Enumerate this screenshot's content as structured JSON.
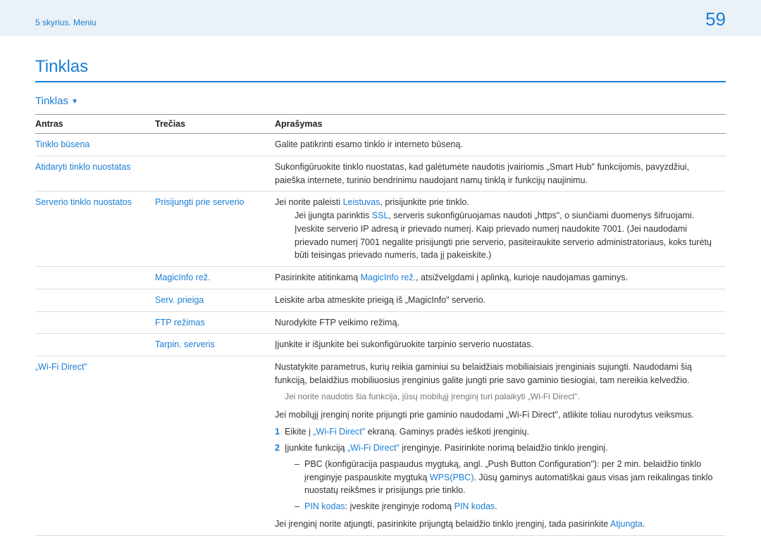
{
  "header": {
    "chapter": "5 skyrius. Meniu",
    "page": "59"
  },
  "title": "Tinklas",
  "sub": "Tinklas",
  "thead": {
    "c1": "Antras",
    "c2": "Trečias",
    "c3": "Aprašymas"
  },
  "rows": {
    "r1": {
      "a": "Tinklo būsena",
      "d": "Galite patikrinti esamo tinklo ir interneto būseną."
    },
    "r2": {
      "a": "Atidaryti tinklo nuostatas",
      "d": "Sukonfigūruokite tinklo nuostatas, kad galėtumėte naudotis įvairiomis „Smart Hub\" funkcijomis, pavyzdžiui, paieška internete, turinio bendrinimu naudojant namų tinklą ir funkcijų naujinimu."
    },
    "r3": {
      "a": "Serverio tinklo nuostatos",
      "b": "Prisijungti prie serverio",
      "d1a": "Jei norite paleisti ",
      "d1b": "Leistuvas",
      "d1c": ", prisijunkite prie tinklo.",
      "d2a": "Jei įjungta parinktis ",
      "d2b": "SSL",
      "d2c": ", serveris sukonfigūruojamas naudoti „https\", o siunčiami duomenys šifruojami.",
      "d3": "Įveskite serverio IP adresą ir prievado numerį. Kaip prievado numerį naudokite 7001. (Jei naudodami prievado numerį 7001 negalite prisijungti prie serverio, pasiteiraukite serverio administratoriaus, koks turėtų būti teisingas prievado numeris, tada jį pakeiskite.)"
    },
    "r4": {
      "b": "MagicInfo rež.",
      "d1": "Pasirinkite atitinkamą ",
      "d2": "MagicInfo rež.",
      "d3": ", atsižvelgdami į aplinką, kurioje naudojamas gaminys."
    },
    "r5": {
      "b": "Serv. prieiga",
      "d": "Leiskite arba atmeskite prieigą iš „MagicInfo\" serverio."
    },
    "r6": {
      "b": "FTP režimas",
      "d": "Nurodykite FTP veikimo režimą."
    },
    "r7": {
      "b": "Tarpin. serveris",
      "d": "Įjunkite ir išjunkite bei sukonfigūruokite tarpinio serverio nuostatas."
    },
    "r8": {
      "a": "„Wi-Fi Direct\"",
      "p1": "Nustatykite parametrus, kurių reikia gaminiui su belaidžiais mobiliaisiais įrenginiais sujungti. Naudodami šią funkciją, belaidžius mobiliuosius įrenginius galite jungti prie savo gaminio tiesiogiai, tam nereikia kelvedžio.",
      "note": "Jei norite naudotis šia funkcija, jūsų mobilųjį įrenginį turi palaikyti „Wi-Fi Direct\".",
      "p2": "Jei mobilųjį įrenginį norite prijungti prie gaminio naudodami „Wi-Fi Direct\", atlikite toliau nurodytus veiksmus.",
      "s1a": "Eikite į ",
      "s1b": "„Wi-Fi Direct\"",
      "s1c": " ekraną. Gaminys pradės ieškoti įrenginių.",
      "s2a": "Įjunkite funkciją ",
      "s2b": "„Wi-Fi Direct\"",
      "s2c": " įrenginyje. Pasirinkite norimą belaidžio tinklo įrenginį.",
      "d1a": "PBC (konfigūracija paspaudus mygtuką, angl. „Push Button Configuration\"): per 2 min. belaidžio tinklo įrenginyje paspauskite mygtuką ",
      "d1b": "WPS(PBC)",
      "d1c": ". Jūsų gaminys automatiškai gaus visas jam reikalingas tinklo nuostatų reikšmes ir prisijungs prie tinklo.",
      "d2a": "PIN kodas",
      "d2b": ": įveskite įrenginyje rodomą ",
      "d2c": "PIN kodas",
      "d2d": ".",
      "p3a": "Jei įrenginį norite atjungti, pasirinkite prijungtą belaidžio tinklo įrenginį, tada pasirinkite ",
      "p3b": "Atjungta",
      "p3c": "."
    }
  }
}
